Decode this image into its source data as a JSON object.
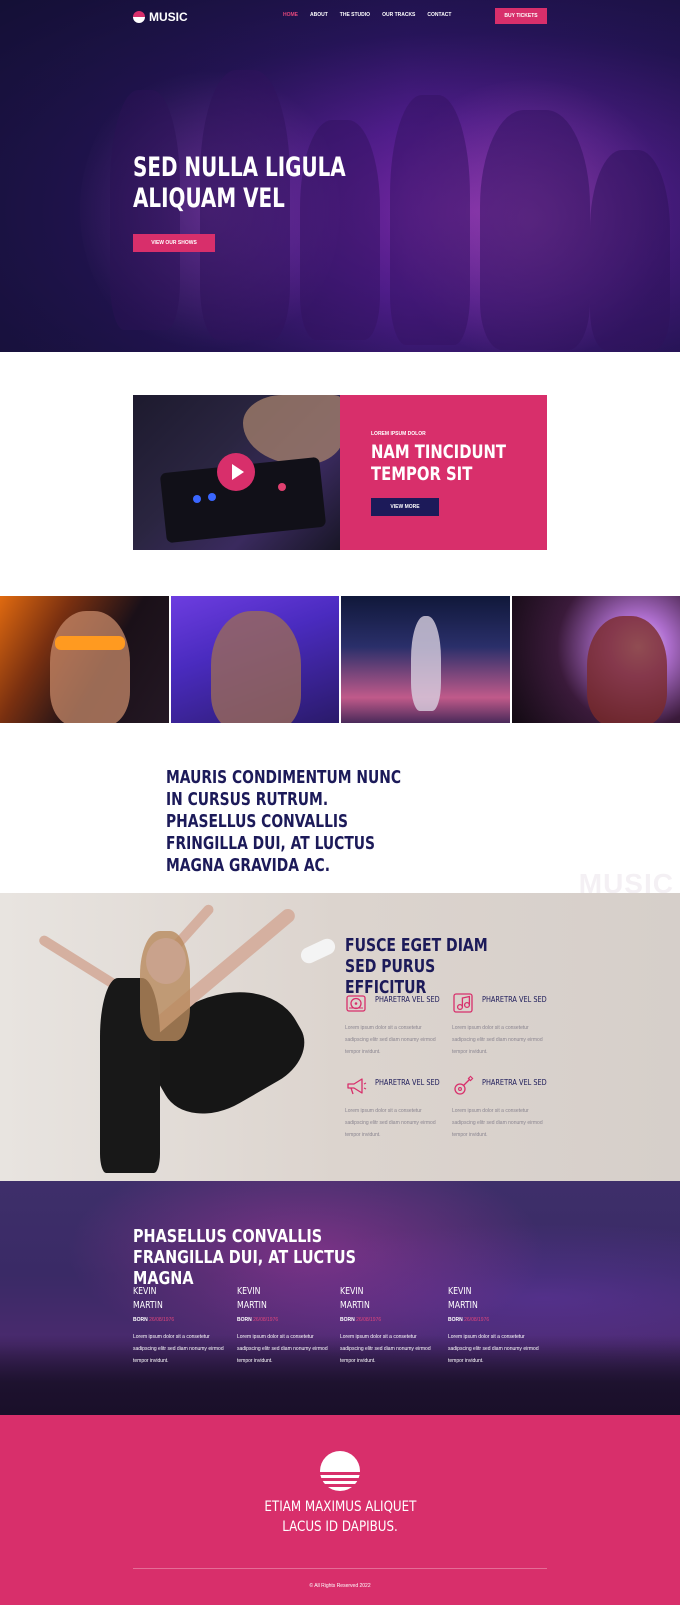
{
  "colors": {
    "accent": "#d82f6b",
    "navy": "#1c1a59",
    "beige": "#dfd8d3"
  },
  "nav": {
    "logo": "MUSIC",
    "menu": [
      "HOME",
      "ABOUT",
      "THE STUDIO",
      "OUR TRACKS",
      "CONTACT"
    ],
    "active": "HOME",
    "cta": "BUY TICKETS"
  },
  "hero": {
    "title": "SED NULLA LIGULA ALIQUAM VEL",
    "button": "VIEW OUR SHOWS"
  },
  "feature": {
    "kicker": "LOREM IPSUM DOLOR",
    "title": "NAM TINCIDUNT TEMPOR SIT",
    "button": "VIEW MORE",
    "play_icon": "play-icon"
  },
  "quote": "MAURIS CONDIMENTUM NUNC IN CURSUS RUTRUM. PHASELLUS CONVALLIS FRINGILLA DUI, AT LUCTUS MAGNA GRAVIDA AC.",
  "watermark": "MUSIC",
  "features": {
    "title": "FUSCE EGET DIAM SED PURUS EFFICITUR",
    "items": [
      {
        "icon": "vinyl-player-icon",
        "title": "PHARETRA VEL SED",
        "text": "Lorem ipsum dolor sit a consetetur sadipscing elitr sed diam nonumy eirmod tempor invidunt."
      },
      {
        "icon": "music-note-icon",
        "title": "PHARETRA VEL SED",
        "text": "Lorem ipsum dolor sit a consetetur sadipscing elitr sed diam nonumy eirmod tempor invidunt."
      },
      {
        "icon": "megaphone-icon",
        "title": "PHARETRA VEL SED",
        "text": "Lorem ipsum dolor sit a consetetur sadipscing elitr sed diam nonumy eirmod tempor invidunt."
      },
      {
        "icon": "guitar-icon",
        "title": "PHARETRA VEL SED",
        "text": "Lorem ipsum dolor sit a consetetur sadipscing elitr sed diam nonumy eirmod tempor invidunt."
      }
    ]
  },
  "people": {
    "title": "PHASELLUS CONVALLIS FRANGILLA DUI, AT LUCTUS MAGNA",
    "born_label": "BORN",
    "items": [
      {
        "first": "KEVIN",
        "last": "MARTIN",
        "born": "26/08/1976",
        "text": "Lorem ipsum dolor sit a consetetur sadipscing elitr sed diam nonumy eirmod tempor invidunt."
      },
      {
        "first": "KEVIN",
        "last": "MARTIN",
        "born": "26/08/1976",
        "text": "Lorem ipsum dolor sit a consetetur sadipscing elitr sed diam nonumy eirmod tempor invidunt."
      },
      {
        "first": "KEVIN",
        "last": "MARTIN",
        "born": "26/08/1976",
        "text": "Lorem ipsum dolor sit a consetetur sadipscing elitr sed diam nonumy eirmod tempor invidunt."
      },
      {
        "first": "KEVIN",
        "last": "MARTIN",
        "born": "26/08/1976",
        "text": "Lorem ipsum dolor sit a consetetur sadipscing elitr sed diam nonumy eirmod tempor invidunt."
      }
    ]
  },
  "footer": {
    "line1": "ETIAM MAXIMUS ALIQUET",
    "line2": "LACUS ID DAPIBUS.",
    "copyright": "© All Rights Reserved 2022"
  }
}
